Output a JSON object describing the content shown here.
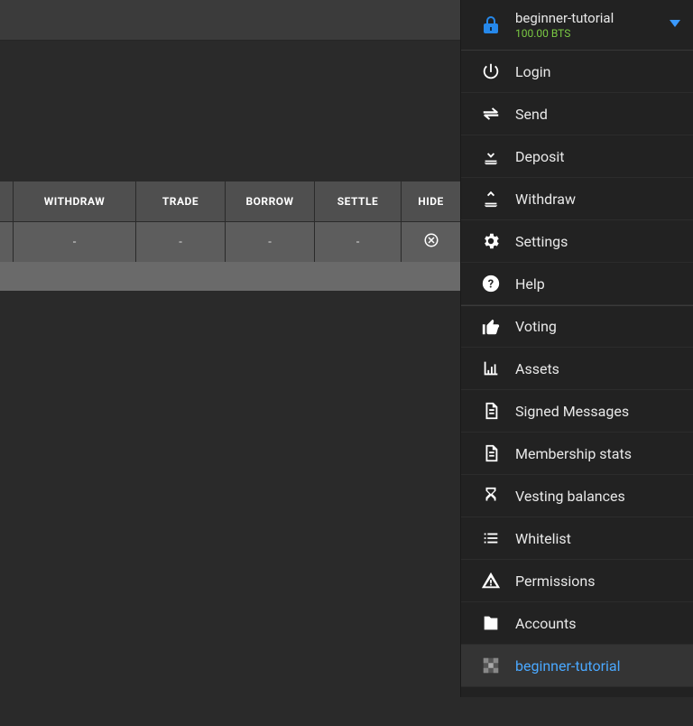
{
  "account": {
    "name": "beginner-tutorial",
    "balance": "100.00 BTS"
  },
  "table": {
    "headers": [
      "WITHDRAW",
      "TRADE",
      "BORROW",
      "SETTLE",
      "HIDE"
    ],
    "row": {
      "withdraw": "-",
      "trade": "-",
      "borrow": "-",
      "settle": "-"
    }
  },
  "menu": {
    "login": "Login",
    "send": "Send",
    "deposit": "Deposit",
    "withdraw": "Withdraw",
    "settings": "Settings",
    "help": "Help",
    "voting": "Voting",
    "assets": "Assets",
    "signed": "Signed Messages",
    "membership": "Membership stats",
    "vesting": "Vesting balances",
    "whitelist": "Whitelist",
    "permissions": "Permissions",
    "accounts": "Accounts",
    "current": "beginner-tutorial"
  }
}
